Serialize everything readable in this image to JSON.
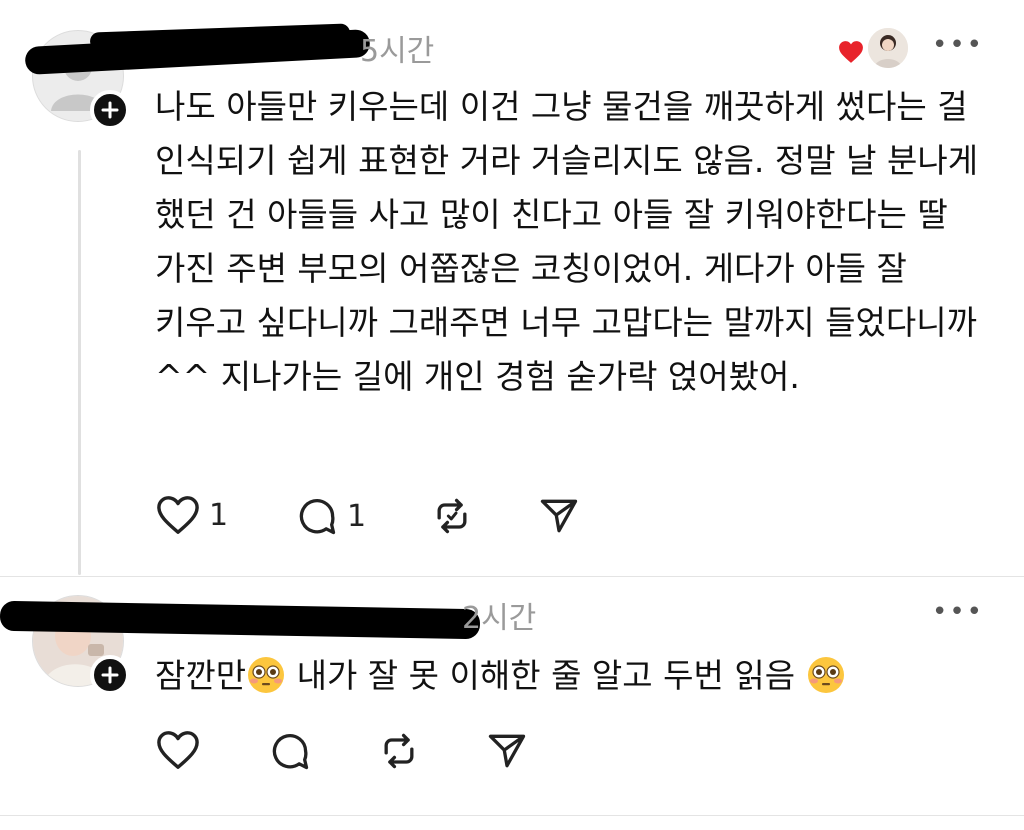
{
  "comments": [
    {
      "time": "5시간",
      "text": "나도 아들만 키우는데 이건 그냥 물건을 깨끗하게 썼다는 걸 인식되기 쉽게 표현한 거라 거슬리지도 않음. 정말 날 분나게 했던 건 아들들 사고 많이 친다고 아들 잘 키워야한다는 딸 가진 주변 부모의 어쭙잖은 코칭이었어. 게다가 아들 잘 키우고 싶다니까 그래주면 너무 고맙다는 말까지 들었다니까 ^^ 지나가는 길에 개인 경험 숟가락 얹어봤어.",
      "like_count": "1",
      "reply_count": "1",
      "more_label": "•••",
      "liked_by_author": true
    },
    {
      "time": "2시간",
      "text_a": "잠깐만",
      "text_b": " 내가 잘 못 이해한 줄 알고 두번 읽음",
      "emoji": "flushed-face",
      "more_label": "•••"
    }
  ],
  "colors": {
    "heart": "#e8232b",
    "muted": "#9a9a9a",
    "line": "#e0e0e0"
  }
}
